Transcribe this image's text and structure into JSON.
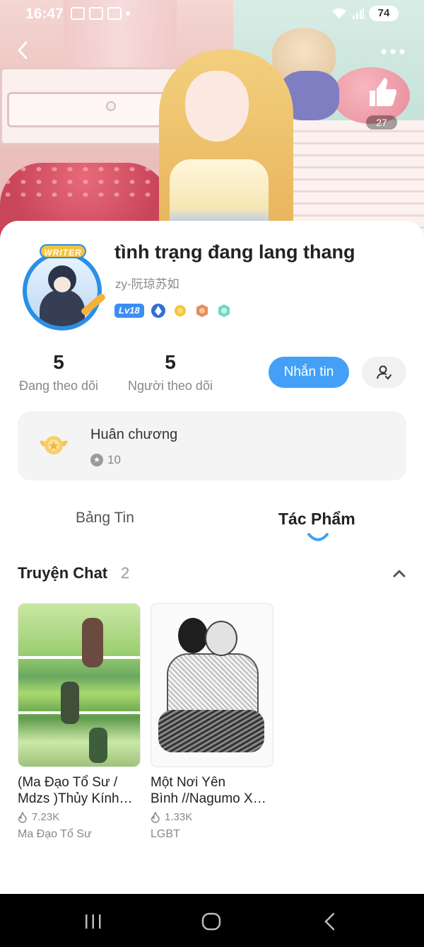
{
  "status_bar": {
    "time": "16:47",
    "battery": "74"
  },
  "header": {
    "likes": "27"
  },
  "profile": {
    "avatar_badge": "WRITER",
    "name": "tình trạng đang lang thang",
    "uid": "zy-阮琼苏如",
    "level": "Lv18",
    "following_count": "5",
    "following_label": "Đang theo dõi",
    "followers_count": "5",
    "followers_label": "Người theo dõi",
    "message_button": "Nhắn tin"
  },
  "medal": {
    "title": "Huân chương",
    "count": "10"
  },
  "tabs": {
    "feed": "Bảng Tin",
    "works": "Tác Phẩm"
  },
  "section": {
    "title": "Truyện Chat",
    "count": "2",
    "stories": [
      {
        "title_line1": "(Ma Đạo Tổ Sư /",
        "title_line2": "Mdzs )Thủy Kính…",
        "views": "7.23K",
        "tag": "Ma Đạo Tổ Sư"
      },
      {
        "title_line1": "Một Nơi Yên",
        "title_line2": "Bình //Nagumo X…",
        "views": "1.33K",
        "tag": "LGBT"
      }
    ]
  },
  "colors": {
    "accent": "#43a0f6",
    "level_chip": "#3a8ff0",
    "nav_bar": "#000000"
  }
}
